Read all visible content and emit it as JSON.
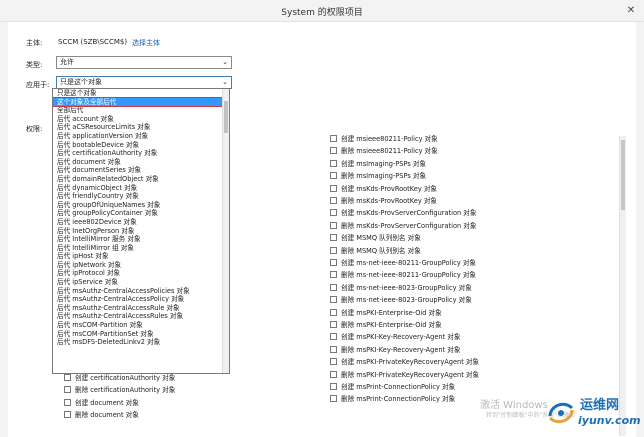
{
  "window": {
    "title": "System 的权限项目",
    "close_glyph": "✕"
  },
  "principal": {
    "label": "主体:",
    "value": "SCCM (SZB\\SCCM$)",
    "link": "选择主体"
  },
  "type": {
    "label": "类型:",
    "value": "允许"
  },
  "apply_to": {
    "label": "应用于:",
    "value": "只是这个对象",
    "options": [
      "只是这个对象",
      "这个对象及全部后代",
      "全部后代",
      "后代 account 对象",
      "后代 aCSResourceLimits 对象",
      "后代 applicationVersion 对象",
      "后代 bootableDevice 对象",
      "后代 certificationAuthority 对象",
      "后代 document 对象",
      "后代 documentSeries 对象",
      "后代 domainRelatedObject 对象",
      "后代 dynamicObject 对象",
      "后代 friendlyCountry 对象",
      "后代 groupOfUniqueNames 对象",
      "后代 groupPolicyContainer 对象",
      "后代 ieee802Device 对象",
      "后代 InetOrgPerson 对象",
      "后代 IntelliMirror 服务 对象",
      "后代 IntelliMirror 组 对象",
      "后代 ipHost 对象",
      "后代 ipNetwork 对象",
      "后代 ipProtocol 对象",
      "后代 ipService 对象",
      "后代 msAuthz-CentralAccessPolicies 对象",
      "后代 msAuthz-CentralAccessPolicy 对象",
      "后代 msAuthz-CentralAccessRule 对象",
      "后代 msAuthz-CentralAccessRules 对象",
      "后代 msCOM-Partition 对象",
      "后代 msCOM-PartitionSet 对象",
      "后代 msDFS-DeletedLinkv2 对象"
    ],
    "selected_index": 1
  },
  "permissions": {
    "label": "权限:",
    "left_column": [
      "创建 certificationAuthority 对象",
      "删除 certificationAuthority 对象",
      "创建 document 对象",
      "删除 document 对象"
    ],
    "right_column": [
      "创建 msieee80211-Policy 对象",
      "删除 msieee80211-Policy 对象",
      "创建 msImaging-PSPs 对象",
      "删除 msImaging-PSPs 对象",
      "创建 msKds-ProvRootKey 对象",
      "删除 msKds-ProvRootKey 对象",
      "创建 msKds-ProvServerConfiguration 对象",
      "删除 msKds-ProvServerConfiguration 对象",
      "创建 MSMQ 队列别名 对象",
      "删除 MSMQ 队列别名 对象",
      "创建 ms-net-ieee-80211-GroupPolicy 对象",
      "删除 ms-net-ieee-80211-GroupPolicy 对象",
      "创建 ms-net-ieee-8023-GroupPolicy 对象",
      "删除 ms-net-ieee-8023-GroupPolicy 对象",
      "创建 msPKI-Enterprise-Oid 对象",
      "删除 msPKI-Enterprise-Oid 对象",
      "创建 msPKI-Key-Recovery-Agent 对象",
      "删除 msPKI-Key-Recovery-Agent 对象",
      "创建 msPKI-PrivateKeyRecoveryAgent 对象",
      "删除 msPKI-PrivateKeyRecoveryAgent 对象",
      "创建 msPrint-ConnectionPolicy 对象",
      "删除 msPrint-ConnectionPolicy 对象"
    ]
  },
  "watermark": {
    "line1": "激活 Windows",
    "line2": "转到\"控制面板\"中的\"系统\"以激活"
  },
  "logo": {
    "brand": "运维网",
    "domain": "iyunv.com"
  }
}
